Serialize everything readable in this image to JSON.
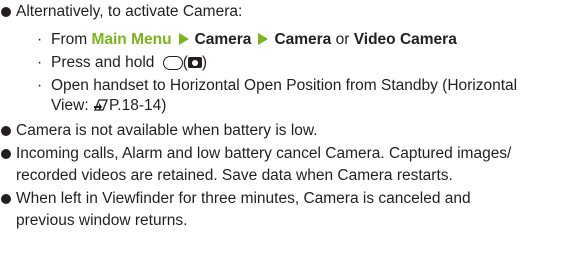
{
  "items": [
    {
      "text": "Alternatively, to activate Camera:",
      "subitems": [
        {
          "prefix": "From ",
          "path": [
            "Main Menu",
            "Camera",
            "Camera"
          ],
          "joiner": " or ",
          "last": "Video Camera"
        },
        {
          "text_before": "Press and hold ",
          "key_icon": "oval-side-key-icon",
          "paren_open": "(",
          "camera_icon": "camera-icon",
          "paren_close": ")"
        },
        {
          "line1": "Open handset to Horizontal Open Position from Standby (Horizontal",
          "line2_before": "View: ",
          "ref_icon": "page-reference-icon",
          "ref": "P.18-14",
          "line2_after": ")"
        }
      ]
    },
    {
      "text": "Camera is not available when battery is low."
    },
    {
      "line1": "Incoming calls, Alarm and low battery cancel Camera. Captured images/",
      "line2": "recorded videos are retained. Save data when Camera restarts."
    },
    {
      "line1": "When left in Viewfinder for three minutes, Camera is canceled and",
      "line2": "previous window returns."
    }
  ],
  "colors": {
    "text": "#231f20",
    "accent_green": "#7ab51d"
  }
}
